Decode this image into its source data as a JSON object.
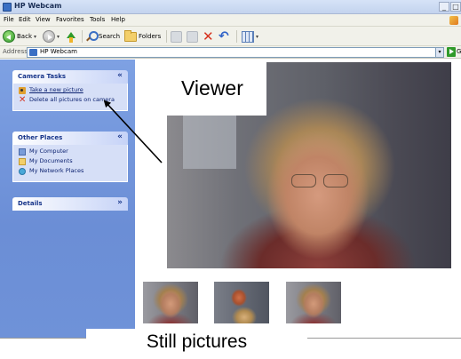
{
  "window": {
    "title": "HP Webcam",
    "controls": {
      "minimize": "_",
      "maximize": "□"
    }
  },
  "menubar": {
    "items": [
      "File",
      "Edit",
      "View",
      "Favorites",
      "Tools",
      "Help"
    ]
  },
  "toolbar": {
    "back_label": "Back",
    "search_label": "Search",
    "folders_label": "Folders"
  },
  "addressbar": {
    "label": "Address",
    "value": "HP Webcam",
    "go_label": "Go"
  },
  "taskpane": {
    "camera_tasks": {
      "title": "Camera Tasks",
      "items": [
        {
          "label": "Take a new picture",
          "icon": "camera-icon"
        },
        {
          "label": "Delete all pictures on camera",
          "icon": "delete-x-icon"
        }
      ]
    },
    "other_places": {
      "title": "Other Places",
      "items": [
        {
          "label": "My Computer",
          "icon": "computer-icon"
        },
        {
          "label": "My Documents",
          "icon": "documents-icon"
        },
        {
          "label": "My Network Places",
          "icon": "network-icon"
        }
      ]
    },
    "details": {
      "title": "Details"
    }
  },
  "annotations": {
    "viewer_label": "Viewer",
    "still_label": "Still pictures"
  },
  "colors": {
    "taskpane_bg": "#6b8ed6",
    "group_head": "#c6d3f7",
    "group_body": "#d6dff7",
    "link_text": "#0c2270",
    "delete_red": "#d6321e"
  }
}
